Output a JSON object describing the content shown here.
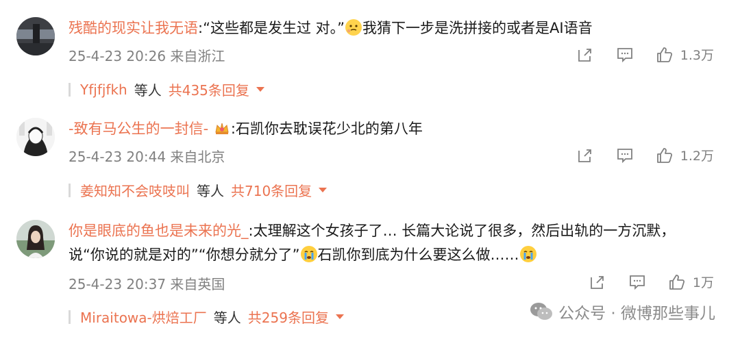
{
  "comments": [
    {
      "username": "残酷的现实让我无语",
      "text_pre": ":“这些都是发生过 对。”",
      "emoji1": "thinking-emoji",
      "text_post": "我猜下一步是洗拼接的或者是AI语音",
      "timestamp": "25-4-23 20:26",
      "location": "来自浙江",
      "likes": "1.3万",
      "reply_user": "Yfjfjfkh",
      "reply_etc": "等人",
      "reply_count": "共435条回复"
    },
    {
      "username": "-致有马公生的一封信-",
      "badge": "crown-badge",
      "text": ":石凯你去耽误花少北的第八年",
      "timestamp": "25-4-23 20:44",
      "location": "来自北京",
      "likes": "1.2万",
      "reply_user": "姜知知不会吱吱叫",
      "reply_etc": "等人",
      "reply_count": "共710条回复"
    },
    {
      "username": "你是眼底的鱼也是未来的光_",
      "text_line1": ":太理解这个女孩子了… 长篇大论说了很多，然后出轨的一方沉默，",
      "text_line2_pre": "说“你说的就是对的”“你想分就分了”",
      "text_line2_mid": "石凯你到底为什么要这么做……",
      "emoji": "crying-emoji",
      "timestamp": "25-4-23 20:37",
      "location": "来自英国",
      "likes": "1万",
      "reply_user": "Miraitowa-烘焙工厂",
      "reply_etc": "等人",
      "reply_count": "共259条回复"
    }
  ],
  "watermark": "公众号 · 微博那些事儿",
  "colors": {
    "accent": "#eb7350",
    "meta": "#808080"
  }
}
